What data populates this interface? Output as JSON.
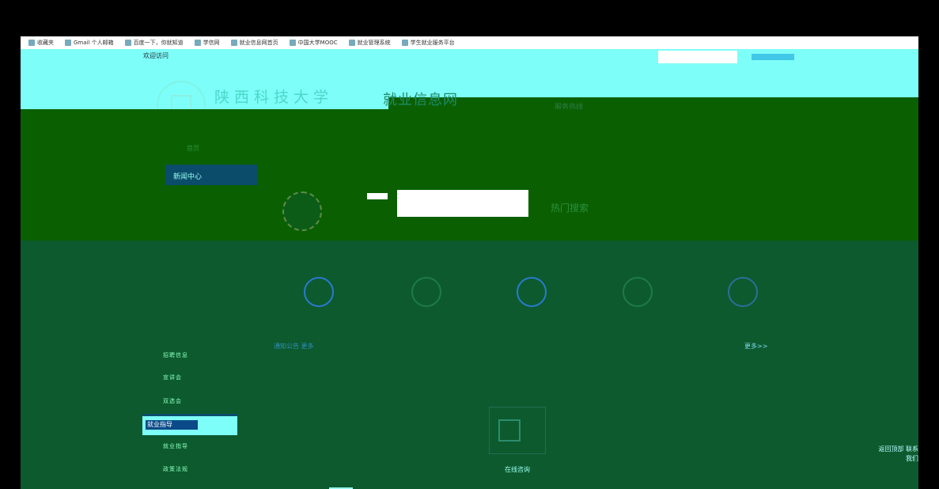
{
  "browser": {
    "bookmarks": [
      {
        "label": "收藏夹"
      },
      {
        "label": "Gmail 个人邮箱"
      },
      {
        "label": "百度一下，你就知道"
      },
      {
        "label": "学信网"
      },
      {
        "label": "就业信息网首页"
      },
      {
        "label": "中国大学MOOC"
      },
      {
        "label": "就业管理系统"
      },
      {
        "label": "学生就业服务平台"
      }
    ]
  },
  "topbar": {
    "welcome": "欢迎访问"
  },
  "header": {
    "school_name": "陕西科技大学",
    "site_name": "就业信息网",
    "right_text": "服务热线"
  },
  "hero": {
    "nav_label": "首页",
    "nav_current": "新闻中心",
    "search_note": "热门搜索"
  },
  "services": {
    "items": [
      {
        "label": "",
        "color": "#2a7ad0"
      },
      {
        "label": "",
        "color": "#1e7a48"
      },
      {
        "label": "",
        "color": "#2a7ad0"
      },
      {
        "label": "",
        "color": "#1e7a48"
      },
      {
        "label": "",
        "color": "#2a6f9a"
      }
    ]
  },
  "news": {
    "link": "通知公告 更多",
    "more": "更多>>"
  },
  "sidebar": {
    "items": [
      {
        "label": "招聘信息"
      },
      {
        "label": "宣讲会"
      },
      {
        "label": "双选会"
      },
      {
        "label": "就业指导"
      },
      {
        "label": "政策法规"
      }
    ],
    "active_tag": "就业指导"
  },
  "center": {
    "label": "在线咨询"
  },
  "corner": {
    "text": "返回顶部 联系我们"
  }
}
